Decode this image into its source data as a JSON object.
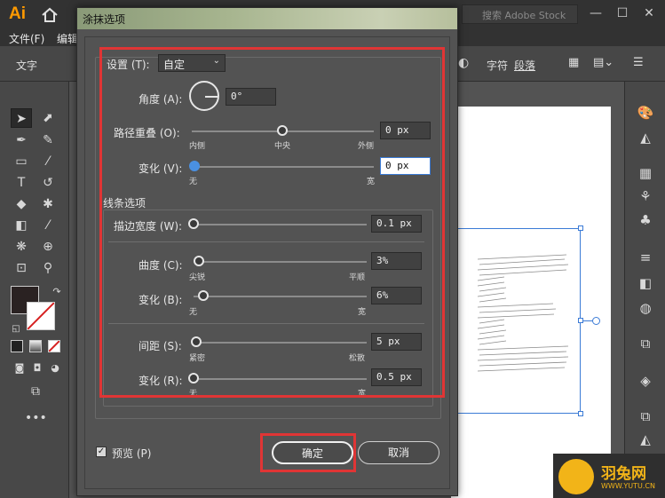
{
  "app": {
    "logo": "Ai",
    "search_placeholder": "搜索 Adobe Stock",
    "menu": [
      "文件(F)",
      "编辑"
    ],
    "control_bar": {
      "type_label": "文字",
      "char_label": "字符",
      "para_label": "段落"
    }
  },
  "dialog": {
    "title": "涂抹选项",
    "settings": {
      "label": "设置 (T):",
      "value": "自定"
    },
    "angle": {
      "label": "角度 (A):",
      "value": "0°"
    },
    "path_overlap": {
      "label": "路径重叠 (O):",
      "value": "0 px",
      "left": "内侧",
      "center": "中央",
      "right": "外侧",
      "position": 0.5
    },
    "variation1": {
      "label": "变化 (V):",
      "value": "0 px",
      "left": "无",
      "right": "宽",
      "position": 0.0
    },
    "line_options_title": "线条选项",
    "stroke_width": {
      "label": "描边宽度 (W):",
      "value": "0.1 px",
      "position": 0.0
    },
    "curviness": {
      "label": "曲度 (C):",
      "value": "3%",
      "left": "尖锐",
      "right": "平顺",
      "position": 0.03
    },
    "variation2": {
      "label": "变化 (B):",
      "value": "6%",
      "left": "无",
      "right": "宽",
      "position": 0.06
    },
    "spacing": {
      "label": "间距 (S):",
      "value": "5 px",
      "left": "紧密",
      "right": "松散",
      "position": 0.03
    },
    "variation3": {
      "label": "变化 (R):",
      "value": "0.5 px",
      "left": "无",
      "right": "宽",
      "position": 0.0
    },
    "preview": {
      "label": "预览 (P)",
      "checked": true
    },
    "ok_label": "确定",
    "cancel_label": "取消"
  },
  "watermark": {
    "name": "羽兔网",
    "url": "WWW.YUTU.CN"
  },
  "colors": {
    "highlight_frame": "#e03535",
    "accent": "#4a90e2",
    "ai_orange": "#ff9a00"
  }
}
